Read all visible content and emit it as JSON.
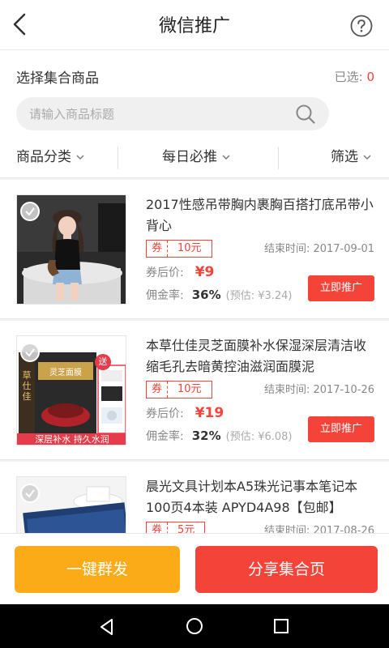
{
  "header": {
    "title": "微信推广"
  },
  "select": {
    "title": "选择集合商品",
    "selected_label": "已选:",
    "selected_count": "0"
  },
  "search": {
    "placeholder": "请输入商品标题"
  },
  "filters": [
    {
      "label": "商品分类"
    },
    {
      "label": "每日必推"
    },
    {
      "label": "筛选"
    }
  ],
  "products": [
    {
      "title": "2017性感吊带胸内裹胸百搭打底吊带小背心",
      "coupon_label": "券",
      "coupon_value": "10元",
      "end_time": "结束时间: 2017-09-01",
      "after_label": "券后价:",
      "price": "¥9",
      "commission_label": "佣金率:",
      "commission_rate": "36%",
      "commission_est": "(预估: ¥3.24)",
      "button": "立即推广"
    },
    {
      "title": "本草仕佳灵芝面膜补水保湿深层清洁收缩毛孔去暗黄控油滋润面膜泥",
      "coupon_label": "券",
      "coupon_value": "10元",
      "end_time": "结束时间: 2017-10-26",
      "after_label": "券后价:",
      "price": "¥19",
      "commission_label": "佣金率:",
      "commission_rate": "32%",
      "commission_est": "(预估: ¥6.08)",
      "button": "立即推广",
      "image_text": {
        "brand": "草仕佳",
        "product": "灵芝面膜",
        "gift": "送",
        "banner": "深层补水 持久水润"
      }
    },
    {
      "title": "晨光文具计划本A5珠光记事本笔记本100页4本装 APYD4A98【包邮】",
      "coupon_label": "券",
      "coupon_value": "5元",
      "end_time": "结束时间: 2017-08-26"
    }
  ],
  "bottom": {
    "broadcast_label": "一键群发",
    "share_label": "分享集合页"
  },
  "colors": {
    "accent_red": "#f4443a",
    "accent_orange": "#fbab18"
  }
}
